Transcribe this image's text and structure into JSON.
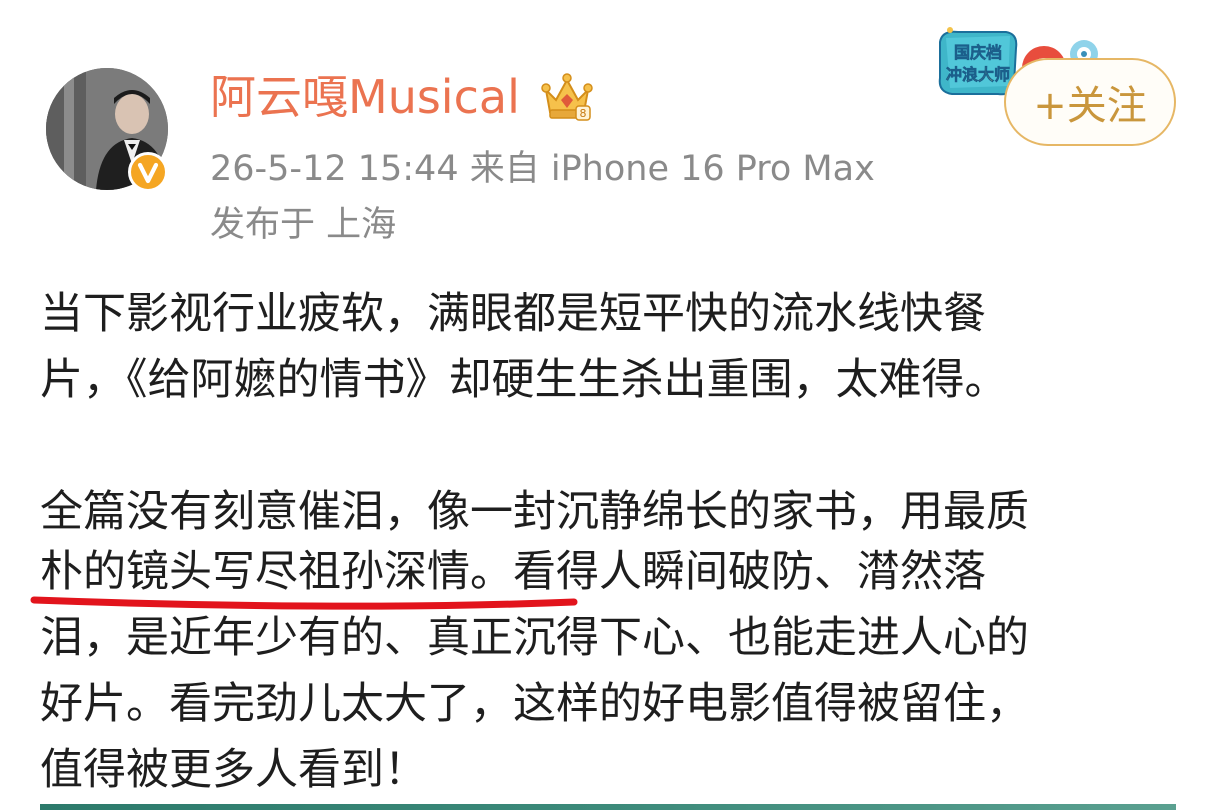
{
  "header": {
    "username": "阿云嘎Musical",
    "time_source": "26-5-12 15:44  来自 iPhone 16 Pro Max",
    "location": "发布于 上海",
    "follow_label": "+关注",
    "badge_text": "国庆档冲浪大师"
  },
  "post": {
    "lines": [
      "当下影视行业疲软，满眼都是短平快的流水线快餐",
      "片，《给阿嬷的情书》却硬生生杀出重围，太难得。",
      "全篇没有刻意催泪，像一封沉静绵长的家书，用最质",
      "朴的镜头写尽祖孙深情。看得人瞬间破防、潸然落",
      "泪，是近年少有的、真正沉得下心、也能走进人心的",
      "好片。看完劲儿太大了，这样的好电影值得被留住，",
      "值得被更多人看到！"
    ],
    "highlighted_phrase": "朴的镜头写尽祖孙深情。"
  },
  "icons": {
    "avatar": "avatar-photo",
    "verified": "verified-v-icon",
    "crown": "crown-icon",
    "badge": "weibo-badge-icon"
  },
  "colors": {
    "username": "#eb7350",
    "meta": "#8a8a8a",
    "follow_border": "#e6b765",
    "follow_text": "#c9963c",
    "underline": "#e2141c",
    "verified": "#f5a623"
  }
}
